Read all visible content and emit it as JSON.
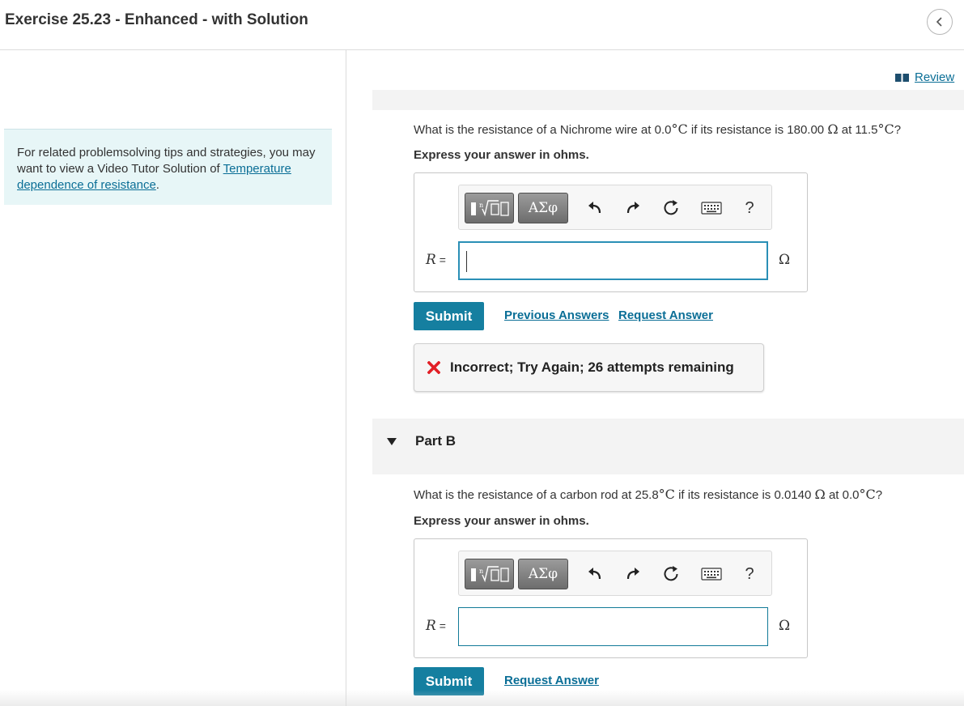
{
  "header": {
    "title": "Exercise 25.23 - Enhanced - with Solution",
    "back_button_icon": "chevron-left-icon"
  },
  "sidebar": {
    "tip_text": "For related problemsolving tips and strategies, you may want to view a Video Tutor Solution of",
    "tip_link": "Temperature dependence of resistance",
    "tip_end": "."
  },
  "review": {
    "label": "Review",
    "icon": "book-icon"
  },
  "toolbar": {
    "templates_icon": "templates-icon",
    "greek_label": "ΑΣφ",
    "undo_icon": "undo-icon",
    "redo_icon": "redo-icon",
    "reset_icon": "reset-icon",
    "keyboard_icon": "keyboard-icon",
    "help_label": "?"
  },
  "partA": {
    "q_text1": "What is the resistance of a Nichrome wire at 0.0",
    "q_deg1": "°C",
    "q_text2": " if its resistance is 180.00 ",
    "q_ohm": "Ω",
    "q_text3": " at 11.5",
    "q_deg2": "°C",
    "q_text4": "?",
    "express": "Express your answer in ohms.",
    "var_name": "R",
    "equals": " =",
    "input_value": "",
    "unit": "Ω",
    "submit_label": "Submit",
    "previous_answers_label": "Previous Answers",
    "request_answer_label": "Request Answer",
    "feedback_text": "Incorrect; Try Again; 26 attempts remaining",
    "feedback_color": "#e21f26"
  },
  "partB": {
    "title": "Part B",
    "q_text1": "What is the resistance of a carbon rod at 25.8",
    "q_deg1": "°C",
    "q_text2": " if its resistance is 0.0140 ",
    "q_ohm": "Ω",
    "q_text3": " at 0.0",
    "q_deg2": "°C",
    "q_text4": "?",
    "express": "Express your answer in ohms.",
    "var_name": "R",
    "equals": " =",
    "input_value": "",
    "unit": "Ω",
    "submit_label": "Submit",
    "request_answer_label": "Request Answer"
  },
  "colors": {
    "accent": "#157fa0",
    "link": "#0a6e96",
    "tip_background": "#e7f6f7"
  }
}
